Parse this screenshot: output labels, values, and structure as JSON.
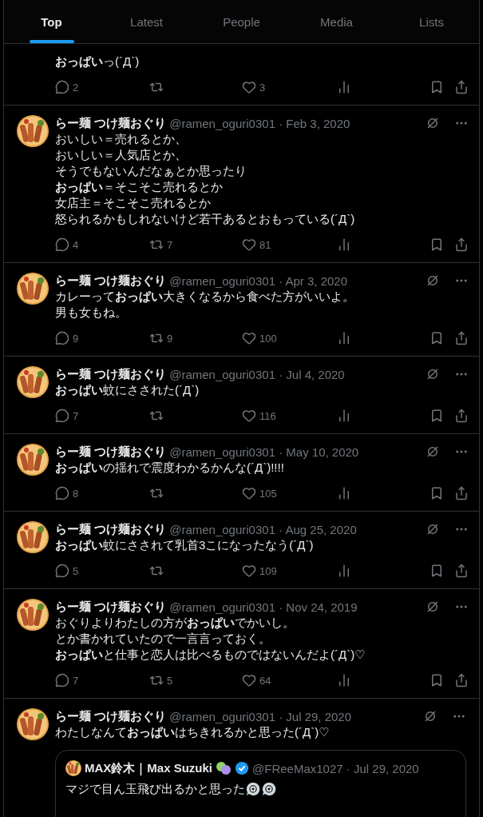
{
  "tabs": [
    {
      "label": "Top",
      "selected": true
    },
    {
      "label": "Latest",
      "selected": false
    },
    {
      "label": "People",
      "selected": false
    },
    {
      "label": "Media",
      "selected": false
    },
    {
      "label": "Lists",
      "selected": false
    }
  ],
  "tweets": [
    {
      "text": [
        "**おっぱい**っ(´Д`)"
      ],
      "replies": "2",
      "likes": "3"
    },
    {
      "name": "らー麺 つけ麺おぐり",
      "meta": "@ramen_oguri0301 · Feb 3, 2020",
      "text": [
        "おいしい＝売れるとか、",
        "おいしい＝人気店とか、",
        "そうでもないんだなぁとか思ったり",
        "**おっぱい**＝そこそこ売れるとか",
        "女店主＝そこそこ売れるとか",
        "怒られるかもしれないけど若干あるとおもっている(´Д`)"
      ],
      "replies": "4",
      "retweets": "7",
      "likes": "81"
    },
    {
      "name": "らー麺 つけ麺おぐり",
      "meta": "@ramen_oguri0301 · Apr 3, 2020",
      "text": [
        "カレーって**おっぱい**大きくなるから食べた方がいいよ。",
        "男も女もね。"
      ],
      "replies": "9",
      "retweets": "9",
      "likes": "100"
    },
    {
      "name": "らー麺 つけ麺おぐり",
      "meta": "@ramen_oguri0301 · Jul 4, 2020",
      "text": [
        "**おっぱい**蚊にさされた(´Д`)"
      ],
      "replies": "7",
      "likes": "116"
    },
    {
      "name": "らー麺 つけ麺おぐり",
      "meta": "@ramen_oguri0301 · May 10, 2020",
      "text": [
        "**おっぱい**の揺れで震度わかるかんな(´Д`)!!!!"
      ],
      "replies": "8",
      "likes": "105"
    },
    {
      "name": "らー麺 つけ麺おぐり",
      "meta": "@ramen_oguri0301 · Aug 25, 2020",
      "text": [
        "**おっぱい**蚊にさされて乳首3こになったなう(´Д`)"
      ],
      "replies": "5",
      "likes": "109"
    },
    {
      "name": "らー麺 つけ麺おぐり",
      "meta": "@ramen_oguri0301 · Nov 24, 2019",
      "text": [
        "おぐりよりわたしの方が**おっぱい**でかいし。",
        "とか書かれていたので一言言っておく。",
        "**おっぱい**と仕事と恋人は比べるものではないんだよ(´Д`)♡"
      ],
      "replies": "7",
      "retweets": "5",
      "likes": "64"
    },
    {
      "name": "らー麺 つけ麺おぐり",
      "meta": "@ramen_oguri0301 · Jul 29, 2020",
      "text": [
        "わたしなんて**おっぱい**はちきれるかと思った(´Д`)♡"
      ],
      "quote": {
        "name": "MAX鈴木｜Max Suzuki",
        "verified": true,
        "meta": "@FReeMax1027 · Jul 29, 2020",
        "text": "マジで目ん玉飛び出るかと思った"
      }
    }
  ]
}
